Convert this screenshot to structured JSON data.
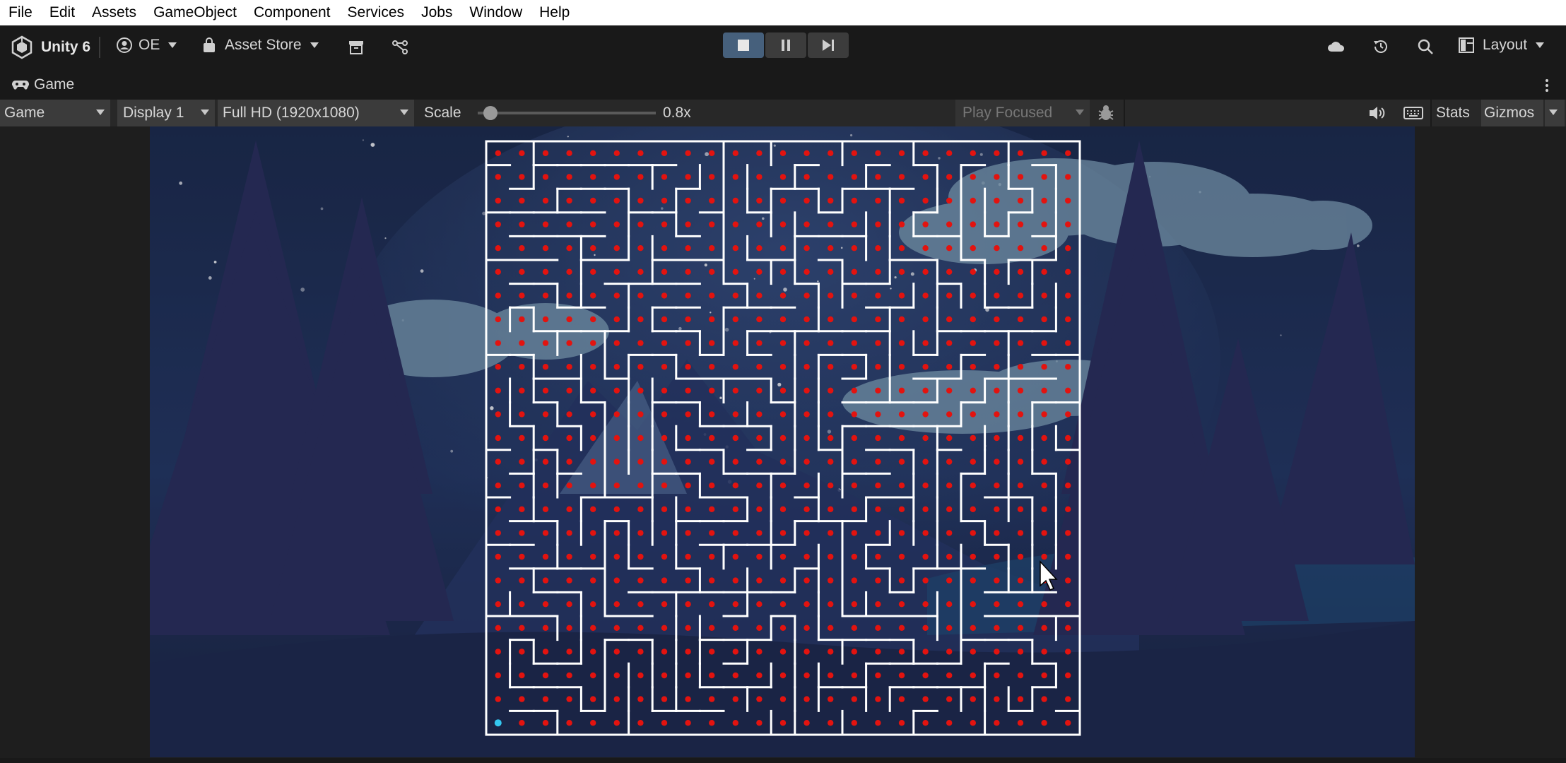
{
  "menu": [
    "File",
    "Edit",
    "Assets",
    "GameObject",
    "Component",
    "Services",
    "Jobs",
    "Window",
    "Help"
  ],
  "toolbar": {
    "app_title": "Unity 6",
    "account_label": "OE",
    "asset_store_label": "Asset Store",
    "layout_label": "Layout"
  },
  "game_tab": {
    "label": "Game"
  },
  "game_toolbar": {
    "view_mode": "Game",
    "display": "Display 1",
    "resolution": "Full HD (1920x1080)",
    "scale_label": "Scale",
    "scale_value": "0.8x",
    "scale_fraction": 0.04,
    "play_mode": "Play Focused",
    "stats_label": "Stats",
    "gizmos_label": "Gizmos"
  },
  "maze": {
    "columns": 25,
    "rows": 25,
    "start": [
      0,
      24
    ]
  },
  "colors": {
    "accent_play": "#46607c",
    "maze_wall": "#ffffff",
    "pellet": "#e3130f",
    "player": "#34c8f0",
    "sky": "#203052"
  },
  "icons": {
    "unity_logo": "unity-logo-icon",
    "account": "account-icon",
    "asset_store": "bag-icon",
    "package": "archive-icon",
    "version_control": "branch-icon",
    "stop": "stop-icon",
    "pause": "pause-icon",
    "step": "step-icon",
    "cloud": "cloud-icon",
    "history": "history-icon",
    "search": "search-icon",
    "layout": "layout-icon",
    "more": "kebab-icon",
    "mute": "speaker-icon",
    "keyboard": "keyboard-icon",
    "bug": "bug-icon"
  }
}
